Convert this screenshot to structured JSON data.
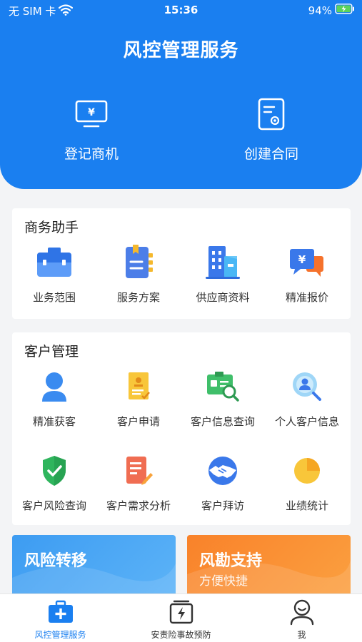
{
  "status_bar": {
    "carrier": "无 SIM 卡",
    "time": "15:36",
    "battery": "94%"
  },
  "header": {
    "title": "风控管理服务",
    "actions": [
      {
        "label": "登记商机",
        "icon": "monitor-yen-icon"
      },
      {
        "label": "创建合同",
        "icon": "contract-document-icon"
      }
    ]
  },
  "business_assistant": {
    "title": "商务助手",
    "items": [
      {
        "label": "业务范围",
        "icon": "briefcase-icon"
      },
      {
        "label": "服务方案",
        "icon": "notebook-icon"
      },
      {
        "label": "供应商资料",
        "icon": "buildings-icon"
      },
      {
        "label": "精准报价",
        "icon": "price-chat-icon"
      }
    ]
  },
  "customer_management": {
    "title": "客户管理",
    "items": [
      {
        "label": "精准获客",
        "icon": "user-icon"
      },
      {
        "label": "客户申请",
        "icon": "application-form-icon"
      },
      {
        "label": "客户信息查询",
        "icon": "id-card-search-icon"
      },
      {
        "label": "个人客户信息",
        "icon": "person-search-icon"
      },
      {
        "label": "客户风险查询",
        "icon": "shield-check-icon"
      },
      {
        "label": "客户需求分析",
        "icon": "document-edit-icon"
      },
      {
        "label": "客户拜访",
        "icon": "handshake-icon"
      },
      {
        "label": "业绩统计",
        "icon": "pie-chart-icon"
      }
    ]
  },
  "promos": [
    {
      "title": "风险转移",
      "subtitle": ""
    },
    {
      "title": "风勘支持",
      "subtitle": "方便快捷"
    }
  ],
  "tab_bar": {
    "tabs": [
      {
        "label": "风控管理服务",
        "icon": "medical-kit-icon",
        "active": true
      },
      {
        "label": "安责险事故预防",
        "icon": "lightning-box-icon",
        "active": false
      },
      {
        "label": "我",
        "icon": "profile-icon",
        "active": false
      }
    ]
  },
  "colors": {
    "primary": "#1a7ff0",
    "promo_blue": "#3a9bf0",
    "promo_orange": "#f98a2a"
  }
}
